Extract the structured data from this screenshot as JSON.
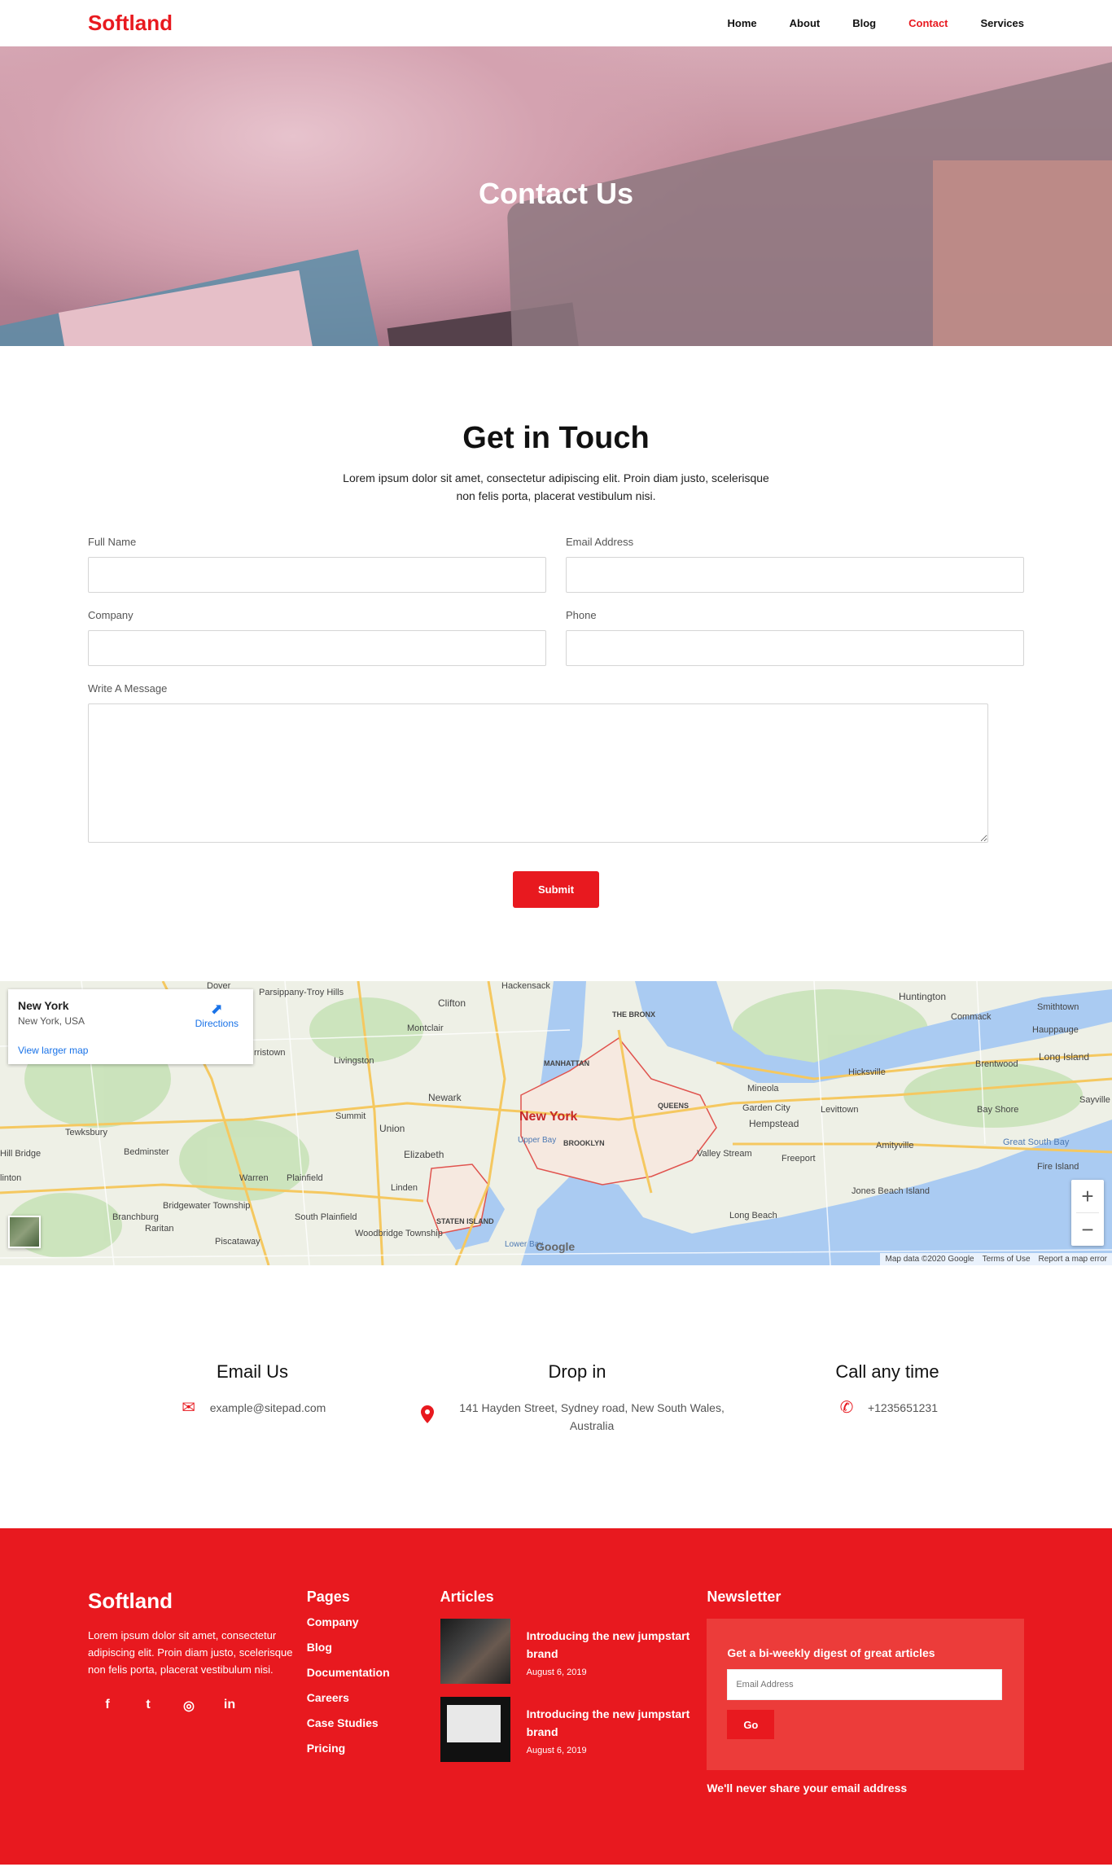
{
  "nav": {
    "brand": "Softland",
    "items": [
      {
        "label": "Home"
      },
      {
        "label": "About"
      },
      {
        "label": "Blog"
      },
      {
        "label": "Contact",
        "active": true
      },
      {
        "label": "Services"
      }
    ]
  },
  "hero": {
    "title": "Contact Us"
  },
  "contact": {
    "title": "Get in Touch",
    "lead": "Lorem ipsum dolor sit amet, consectetur adipiscing elit. Proin diam justo, scelerisque non felis porta, placerat vestibulum nisi.",
    "fields": {
      "full_name": "Full Name",
      "email": "Email Address",
      "company": "Company",
      "phone": "Phone",
      "message": "Write A Message"
    },
    "submit": "Submit"
  },
  "map": {
    "card_title": "New York",
    "card_subtitle": "New York, USA",
    "directions": "Directions",
    "larger": "View larger map",
    "city": "New York",
    "google": "Google",
    "footer": [
      "Map data ©2020 Google",
      "Terms of Use",
      "Report a map error"
    ],
    "labels": [
      "Parsippany-Troy Hills",
      "Clifton",
      "Hackensack",
      "Montclair",
      "THE BRONX",
      "Huntington",
      "Smithtown",
      "Commack",
      "Hauppauge",
      "Livingston",
      "MANHATTAN",
      "Newark",
      "QUEENS",
      "Mineola",
      "Hicksville",
      "Long Island",
      "Brentwood",
      "Summit",
      "Union",
      "Garden City",
      "Hempstead",
      "Levittown",
      "Bay Shore",
      "Sayville",
      "Tewksbury",
      "Elizabeth",
      "BROOKLYN",
      "Valley Stream",
      "Freeport",
      "Amityville",
      "Great South Bay",
      "Fire Island",
      "Bedminster",
      "Warren",
      "Plainfield",
      "Linden",
      "Bridgewater Township",
      "Branchburg",
      "South Plainfield",
      "Raritan",
      "STATEN ISLAND",
      "Jones Beach Island",
      "Long Beach",
      "Woodbridge Township",
      "Piscataway",
      "Dover",
      "rristown",
      "Upper Bay",
      "Lower Bay",
      "Hill Bridge",
      "linton"
    ],
    "zoom_in": "+",
    "zoom_out": "−"
  },
  "info": [
    {
      "title": "Email Us",
      "text": "example@sitepad.com",
      "icon": "envelope-icon"
    },
    {
      "title": "Drop in",
      "text": "141 Hayden Street, Sydney road, New South Wales, Australia",
      "icon": "map-pin-icon"
    },
    {
      "title": "Call any time",
      "text": "+1235651231",
      "icon": "phone-icon"
    }
  ],
  "footer": {
    "brand": "Softland",
    "about": "Lorem ipsum dolor sit amet, consectetur adipiscing elit. Proin diam justo, scelerisque non felis porta, placerat vestibulum nisi.",
    "social": [
      "f",
      "t",
      "◎",
      "in"
    ],
    "pages_title": "Pages",
    "pages": [
      "Company",
      "Blog",
      "Documentation",
      "Careers",
      "Case Studies",
      "Pricing"
    ],
    "articles_title": "Articles",
    "articles": [
      {
        "title": "Introducing the new jumpstart brand",
        "date": "August 6, 2019"
      },
      {
        "title": "Introducing the new jumpstart brand",
        "date": "August 6, 2019"
      }
    ],
    "newsletter_title": "Newsletter",
    "newsletter_text": "Get a bi-weekly digest of great articles",
    "newsletter_placeholder": "Email Address",
    "newsletter_button": "Go",
    "newsletter_note": "We'll never share your email address"
  },
  "colors": {
    "accent": "#e8191f",
    "footer_panel": "#ec3c3a"
  }
}
